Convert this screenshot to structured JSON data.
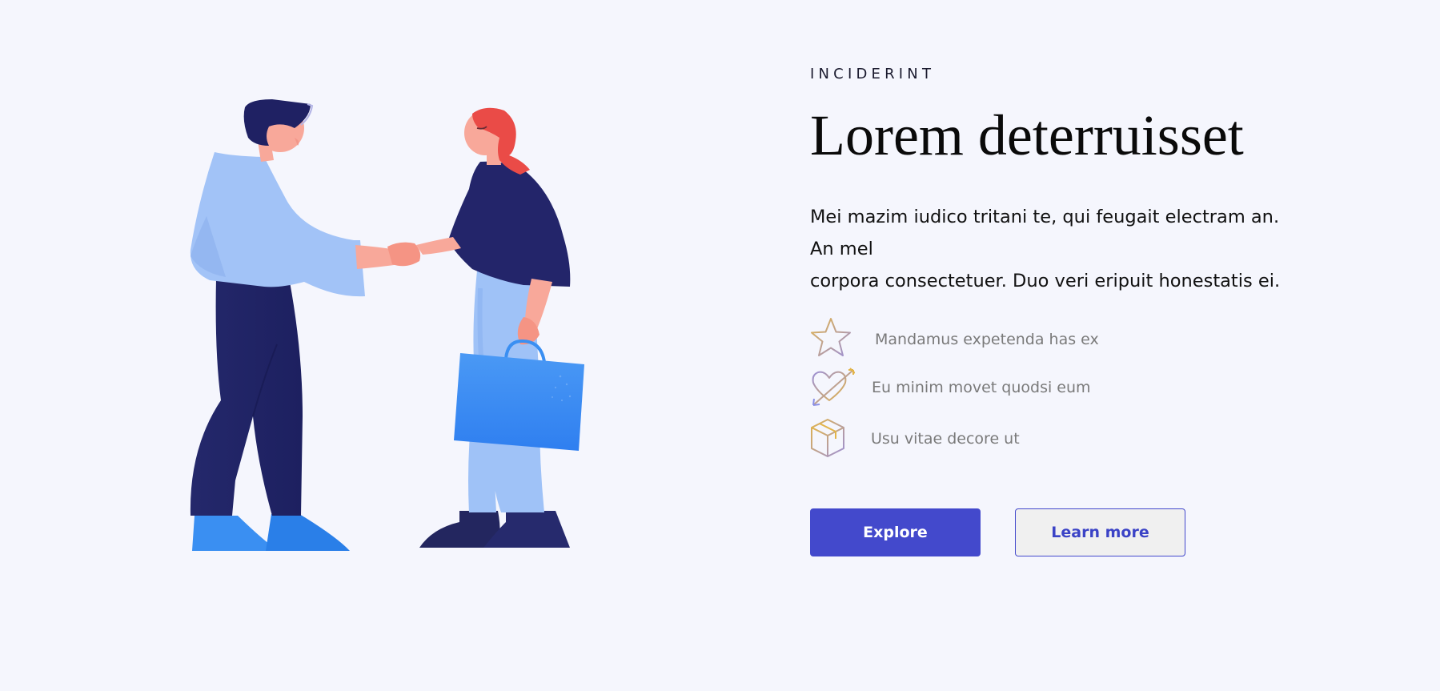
{
  "hero": {
    "eyebrow": "INCIDERINT",
    "title": "Lorem deterruisset",
    "description_lines": [
      "Mei mazim iudico tritani te, qui feugait electram an.",
      "An mel",
      "corpora consectetuer. Duo veri eripuit honestatis ei."
    ],
    "features": [
      {
        "icon": "star-icon",
        "label": "Mandamus expetenda has ex"
      },
      {
        "icon": "heart-arrow-icon",
        "label": "Eu minim movet quodsi eum"
      },
      {
        "icon": "box-icon",
        "label": "Usu vitae decore ut"
      }
    ],
    "buttons": {
      "primary_label": "Explore",
      "secondary_label": "Learn more"
    }
  },
  "illustration": {
    "name": "handshake-illustration"
  },
  "colors": {
    "background": "#f5f6fd",
    "primary": "#4349cc",
    "primary_text": "#ffffff",
    "secondary_bg": "#f0f0f0",
    "secondary_text": "#3b43c6",
    "feature_text": "#7a7a7a",
    "icon_gold": "#e2b44a",
    "icon_purple": "#9b8fd6",
    "navy": "#232566",
    "light_blue": "#a2c3f7",
    "blue": "#3a8ff2",
    "red_hair": "#ea4b47",
    "skin": "#f8a89a"
  }
}
